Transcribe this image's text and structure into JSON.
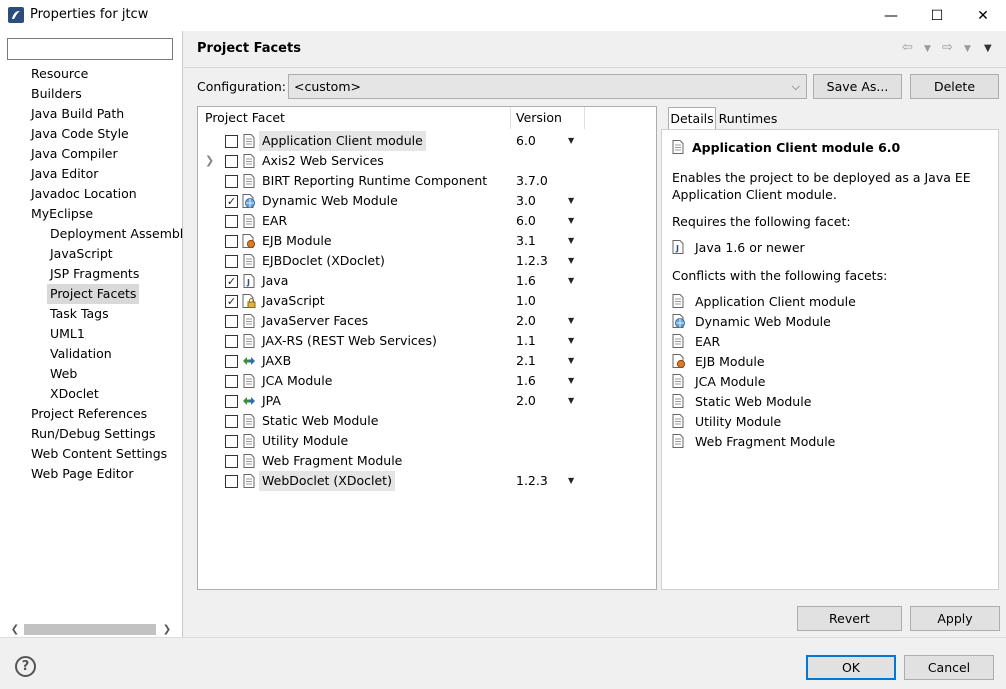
{
  "window": {
    "title": "Properties for jtcw",
    "minimize": "—",
    "maximize": "☐",
    "close": "✕"
  },
  "left_tree": {
    "filter_placeholder": "",
    "items": [
      {
        "label": "Resource",
        "level": 1,
        "selected": false
      },
      {
        "label": "Builders",
        "level": 1,
        "selected": false
      },
      {
        "label": "Java Build Path",
        "level": 1,
        "selected": false
      },
      {
        "label": "Java Code Style",
        "level": 1,
        "selected": false
      },
      {
        "label": "Java Compiler",
        "level": 1,
        "selected": false
      },
      {
        "label": "Java Editor",
        "level": 1,
        "selected": false
      },
      {
        "label": "Javadoc Location",
        "level": 1,
        "selected": false
      },
      {
        "label": "MyEclipse",
        "level": 1,
        "selected": false
      },
      {
        "label": "Deployment Assembl",
        "level": 2,
        "selected": false
      },
      {
        "label": "JavaScript",
        "level": 2,
        "selected": false
      },
      {
        "label": "JSP Fragments",
        "level": 2,
        "selected": false
      },
      {
        "label": "Project Facets",
        "level": 2,
        "selected": true
      },
      {
        "label": "Task Tags",
        "level": 2,
        "selected": false
      },
      {
        "label": "UML1",
        "level": 2,
        "selected": false
      },
      {
        "label": "Validation",
        "level": 2,
        "selected": false
      },
      {
        "label": "Web",
        "level": 2,
        "selected": false
      },
      {
        "label": "XDoclet",
        "level": 2,
        "selected": false
      },
      {
        "label": "Project References",
        "level": 1,
        "selected": false
      },
      {
        "label": "Run/Debug Settings",
        "level": 1,
        "selected": false
      },
      {
        "label": "Web Content Settings",
        "level": 1,
        "selected": false
      },
      {
        "label": "Web Page Editor",
        "level": 1,
        "selected": false
      }
    ]
  },
  "page": {
    "title": "Project Facets"
  },
  "configuration": {
    "label": "Configuration:",
    "value": "<custom>",
    "save_as": "Save As...",
    "delete": "Delete"
  },
  "facets_table": {
    "col_facet": "Project Facet",
    "col_version": "Version",
    "rows": [
      {
        "name": "Application Client module",
        "version": "6.0",
        "checked": false,
        "dropdown": true,
        "icon": "page-icon",
        "highlight": true,
        "expandable": false
      },
      {
        "name": "Axis2 Web Services",
        "version": "",
        "checked": false,
        "dropdown": false,
        "icon": "page-icon",
        "highlight": false,
        "expandable": true
      },
      {
        "name": "BIRT Reporting Runtime Component",
        "version": "3.7.0",
        "checked": false,
        "dropdown": false,
        "icon": "page-icon",
        "highlight": false,
        "expandable": false
      },
      {
        "name": "Dynamic Web Module",
        "version": "3.0",
        "checked": true,
        "dropdown": true,
        "icon": "globe-page-icon",
        "highlight": false,
        "expandable": false
      },
      {
        "name": "EAR",
        "version": "6.0",
        "checked": false,
        "dropdown": true,
        "icon": "page-icon",
        "highlight": false,
        "expandable": false
      },
      {
        "name": "EJB Module",
        "version": "3.1",
        "checked": false,
        "dropdown": true,
        "icon": "ejb-icon",
        "highlight": false,
        "expandable": false
      },
      {
        "name": "EJBDoclet (XDoclet)",
        "version": "1.2.3",
        "checked": false,
        "dropdown": true,
        "icon": "page-icon",
        "highlight": false,
        "expandable": false
      },
      {
        "name": "Java",
        "version": "1.6",
        "checked": true,
        "dropdown": true,
        "icon": "java-icon",
        "highlight": false,
        "expandable": false
      },
      {
        "name": "JavaScript",
        "version": "1.0",
        "checked": true,
        "dropdown": false,
        "icon": "lock-page-icon",
        "highlight": false,
        "expandable": false
      },
      {
        "name": "JavaServer Faces",
        "version": "2.0",
        "checked": false,
        "dropdown": true,
        "icon": "page-icon",
        "highlight": false,
        "expandable": false
      },
      {
        "name": "JAX-RS (REST Web Services)",
        "version": "1.1",
        "checked": false,
        "dropdown": true,
        "icon": "page-icon",
        "highlight": false,
        "expandable": false
      },
      {
        "name": "JAXB",
        "version": "2.1",
        "checked": false,
        "dropdown": true,
        "icon": "arrows-icon",
        "highlight": false,
        "expandable": false
      },
      {
        "name": "JCA Module",
        "version": "1.6",
        "checked": false,
        "dropdown": true,
        "icon": "page-icon",
        "highlight": false,
        "expandable": false
      },
      {
        "name": "JPA",
        "version": "2.0",
        "checked": false,
        "dropdown": true,
        "icon": "arrows-icon",
        "highlight": false,
        "expandable": false
      },
      {
        "name": "Static Web Module",
        "version": "",
        "checked": false,
        "dropdown": false,
        "icon": "page-icon",
        "highlight": false,
        "expandable": false
      },
      {
        "name": "Utility Module",
        "version": "",
        "checked": false,
        "dropdown": false,
        "icon": "page-icon",
        "highlight": false,
        "expandable": false
      },
      {
        "name": "Web Fragment Module",
        "version": "",
        "checked": false,
        "dropdown": false,
        "icon": "page-icon",
        "highlight": false,
        "expandable": false
      },
      {
        "name": "WebDoclet (XDoclet)",
        "version": "1.2.3",
        "checked": false,
        "dropdown": true,
        "icon": "page-icon",
        "highlight": true,
        "expandable": false
      }
    ]
  },
  "details": {
    "tab_details": "Details",
    "tab_runtimes": "Runtimes",
    "heading": "Application Client module 6.0",
    "description_line1": "Enables the project to be deployed as a Java EE",
    "description_line2": "Application Client module.",
    "requires_label": "Requires the following facet:",
    "requires": [
      {
        "label": "Java 1.6 or newer",
        "icon": "java-icon"
      }
    ],
    "conflicts_label": "Conflicts with the following facets:",
    "conflicts": [
      {
        "label": "Application Client module",
        "icon": "page-icon"
      },
      {
        "label": "Dynamic Web Module",
        "icon": "globe-page-icon"
      },
      {
        "label": "EAR",
        "icon": "page-icon"
      },
      {
        "label": "EJB Module",
        "icon": "ejb-icon"
      },
      {
        "label": "JCA Module",
        "icon": "page-icon"
      },
      {
        "label": "Static Web Module",
        "icon": "page-icon"
      },
      {
        "label": "Utility Module",
        "icon": "page-icon"
      },
      {
        "label": "Web Fragment Module",
        "icon": "page-icon"
      }
    ]
  },
  "buttons": {
    "revert": "Revert",
    "apply": "Apply",
    "ok": "OK",
    "cancel": "Cancel",
    "help": "?"
  },
  "colors": {
    "ok_border": "#0078d7",
    "selected_bg": "#d9d9d9"
  }
}
